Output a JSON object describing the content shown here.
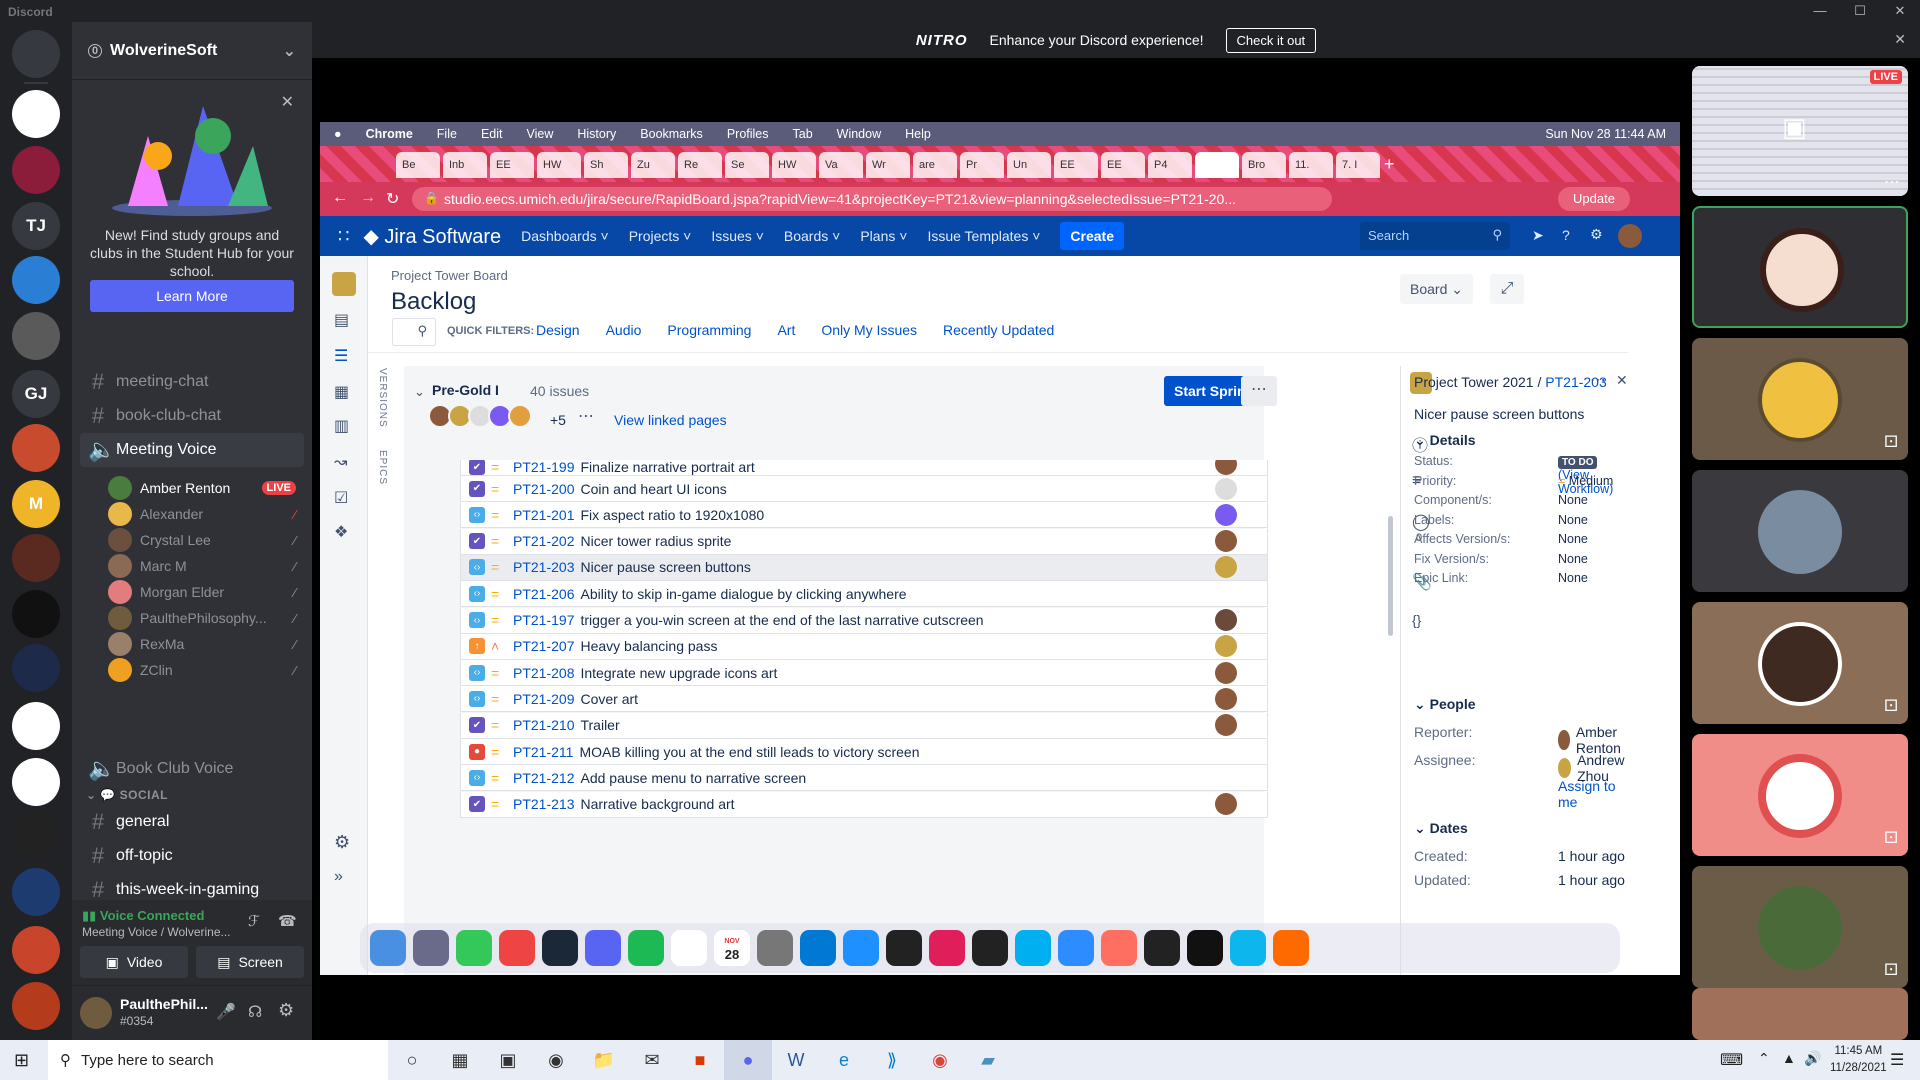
{
  "window": {
    "title": "Discord"
  },
  "nitro": {
    "brand": "NITRO",
    "text": "Enhance your Discord experience!",
    "cta": "Check it out"
  },
  "server": {
    "name": "WolverineSoft"
  },
  "servers": [
    {
      "label": "",
      "color": "#36393f"
    },
    {
      "label": "",
      "color": "#fff"
    },
    {
      "label": "",
      "color": "#8b1c3a"
    },
    {
      "label": "TJ",
      "color": "#36393f"
    },
    {
      "label": "",
      "color": "#2a7fd4"
    },
    {
      "label": "",
      "color": "#5a5a5a"
    },
    {
      "label": "GJ",
      "color": "#36393f"
    },
    {
      "label": "",
      "color": "#c84b2e"
    },
    {
      "label": "M",
      "color": "#f0b429"
    },
    {
      "label": "",
      "color": "#5a2a20"
    },
    {
      "label": "",
      "color": "#111"
    },
    {
      "label": "",
      "color": "#1d2a4a"
    },
    {
      "label": "",
      "color": "#fff"
    },
    {
      "label": "",
      "color": "#fff"
    },
    {
      "label": "",
      "color": "#222"
    },
    {
      "label": "",
      "color": "#1d3b6e"
    },
    {
      "label": "",
      "color": "#c8442a"
    },
    {
      "label": "",
      "color": "#b53b1d"
    }
  ],
  "promo": {
    "text": "New! Find study groups and clubs in the Student Hub for your school.",
    "button": "Learn More"
  },
  "channels": {
    "meeting_chat": "meeting-chat",
    "book_club_chat": "book-club-chat",
    "meeting_voice": "Meeting Voice",
    "book_club_voice": "Book Club Voice",
    "social_category": "SOCIAL",
    "general": "general",
    "off_topic": "off-topic",
    "this_week": "this-week-in-gaming"
  },
  "voice_users": [
    {
      "name": "Amber Renton",
      "badge": "LIVE",
      "color": "#4a7c3f"
    },
    {
      "name": "Alexander",
      "badge": "",
      "color": "#e8b84a"
    },
    {
      "name": "Crystal Lee",
      "badge": "",
      "color": "#6b5040"
    },
    {
      "name": "Marc M",
      "badge": "",
      "color": "#8a6a55"
    },
    {
      "name": "Morgan Elder",
      "badge": "",
      "color": "#e37d7d"
    },
    {
      "name": "PaulthePhilosophy...",
      "badge": "",
      "color": "#6f5c3e"
    },
    {
      "name": "RexMa",
      "badge": "",
      "color": "#9a7f6a"
    },
    {
      "name": "ZClin",
      "badge": "",
      "color": "#f0a020"
    }
  ],
  "voice_connected": {
    "status": "Voice Connected",
    "channel": "Meeting Voice / Wolverine...",
    "video": "Video",
    "screen": "Screen"
  },
  "user": {
    "name": "PaulthePhil...",
    "tag": "#0354"
  },
  "mac_menu": {
    "apple": "",
    "items": [
      "Chrome",
      "File",
      "Edit",
      "View",
      "History",
      "Bookmarks",
      "Profiles",
      "Tab",
      "Window",
      "Help"
    ],
    "clock": "Sun Nov 28  11:44 AM"
  },
  "chrome_tabs": [
    "Be",
    "Inb",
    "EE",
    "HW",
    "Sh",
    "Zu",
    "Re",
    "Se",
    "HW",
    "Va",
    "Wr",
    "are",
    "Pr",
    "Un",
    "EE",
    "EE",
    "P4",
    "",
    "Bro",
    "11.",
    "7. I"
  ],
  "url": "studio.eecs.umich.edu/jira/secure/RapidBoard.jspa?rapidView=41&projectKey=PT21&view=planning&selectedIssue=PT21-20...",
  "update_label": "Update",
  "jira_nav": {
    "logo": "Jira Software",
    "items": [
      "Dashboards",
      "Projects",
      "Issues",
      "Boards",
      "Plans",
      "Issue Templates"
    ],
    "create": "Create",
    "search": "Search"
  },
  "board": {
    "breadcrumb": "Project Tower Board",
    "title": "Backlog",
    "board_btn": "Board",
    "quick_filters_label": "QUICK FILTERS:",
    "filters": [
      "Design",
      "Audio",
      "Programming",
      "Art",
      "Only My Issues",
      "Recently Updated"
    ]
  },
  "side_tabs": {
    "versions": "VERSIONS",
    "epics": "EPICS"
  },
  "sprint": {
    "name": "Pre-Gold I",
    "count": "40 issues",
    "extra": "+5",
    "linked": "View linked pages",
    "start": "Start Sprint"
  },
  "issues": [
    {
      "key": "PT21-199",
      "summary": "Finalize narrative portrait art",
      "type": "story",
      "priority": "medium",
      "assignee": "#8b5a3c"
    },
    {
      "key": "PT21-200",
      "summary": "Coin and heart UI icons",
      "type": "story",
      "priority": "medium",
      "assignee": "#ddd"
    },
    {
      "key": "PT21-201",
      "summary": "Fix aspect ratio to 1920x1080",
      "type": "task",
      "priority": "medium",
      "assignee": "#7a5af0"
    },
    {
      "key": "PT21-202",
      "summary": "Nicer tower radius sprite",
      "type": "story",
      "priority": "medium",
      "assignee": "#8b5a3c"
    },
    {
      "key": "PT21-203",
      "summary": "Nicer pause screen buttons",
      "type": "task",
      "priority": "medium",
      "assignee": "#c9a445"
    },
    {
      "key": "PT21-206",
      "summary": "Ability to skip in-game dialogue by clicking anywhere",
      "type": "task",
      "priority": "medium",
      "assignee": ""
    },
    {
      "key": "PT21-197",
      "summary": "trigger a you-win screen at the end of the last narrative cutscreen",
      "type": "task",
      "priority": "medium",
      "assignee": "#6a4a3a"
    },
    {
      "key": "PT21-207",
      "summary": "Heavy balancing pass",
      "type": "improve",
      "priority": "high",
      "assignee": "#c9a445"
    },
    {
      "key": "PT21-208",
      "summary": "Integrate new upgrade icons art",
      "type": "task",
      "priority": "medium",
      "assignee": "#8b5a3c"
    },
    {
      "key": "PT21-209",
      "summary": "Cover art",
      "type": "task",
      "priority": "medium",
      "assignee": "#8b5a3c"
    },
    {
      "key": "PT21-210",
      "summary": "Trailer",
      "type": "story",
      "priority": "medium",
      "assignee": "#8b5a3c"
    },
    {
      "key": "PT21-211",
      "summary": "MOAB killing you at the end still leads to victory screen",
      "type": "bug",
      "priority": "medium",
      "assignee": ""
    },
    {
      "key": "PT21-212",
      "summary": "Add pause menu to narrative screen",
      "type": "task",
      "priority": "medium",
      "assignee": ""
    },
    {
      "key": "PT21-213",
      "summary": "Narrative background art",
      "type": "story",
      "priority": "medium",
      "assignee": "#8b5a3c"
    }
  ],
  "detail": {
    "project": "Project Tower 2021",
    "key": "PT21-203",
    "summary": "Nicer pause screen buttons",
    "details_title": "Details",
    "fields": [
      {
        "label": "Status:",
        "value": "TO DO",
        "extra": "(View Workflow)"
      },
      {
        "label": "Priority:",
        "value": "Medium"
      },
      {
        "label": "Component/s:",
        "value": "None"
      },
      {
        "label": "Labels:",
        "value": "None"
      },
      {
        "label": "Affects Version/s:",
        "value": "None"
      },
      {
        "label": "Fix Version/s:",
        "value": "None"
      },
      {
        "label": "Epic Link:",
        "value": "None"
      }
    ],
    "people_title": "People",
    "reporter_label": "Reporter:",
    "reporter": "Amber Renton",
    "assignee_label": "Assignee:",
    "assignee": "Andrew Zhou",
    "assign_me": "Assign to me",
    "dates_title": "Dates",
    "created_label": "Created:",
    "created": "1 hour ago",
    "updated_label": "Updated:",
    "updated": "1 hour ago",
    "comments_count": "0"
  },
  "dock_colors": [
    "#4a90e2",
    "#6a6a8a",
    "#34c759",
    "#e44",
    "#1b2838",
    "#5865f2",
    "#1db954",
    "#fff",
    "#25d366",
    "#777",
    "#0078d4",
    "#1e90ff",
    "#222",
    "#e01e5a",
    "#222",
    "#00aff0",
    "#2d8cff",
    "#ff6f61",
    "#222",
    "#111",
    "#0db7ed",
    "#ff6a00"
  ],
  "dock_calendar": {
    "month": "NOV",
    "day": "28"
  },
  "rightcol": {
    "live": "LIVE"
  },
  "taskbar": {
    "search": "Type here to search",
    "time": "11:45 AM",
    "date": "11/28/2021"
  }
}
